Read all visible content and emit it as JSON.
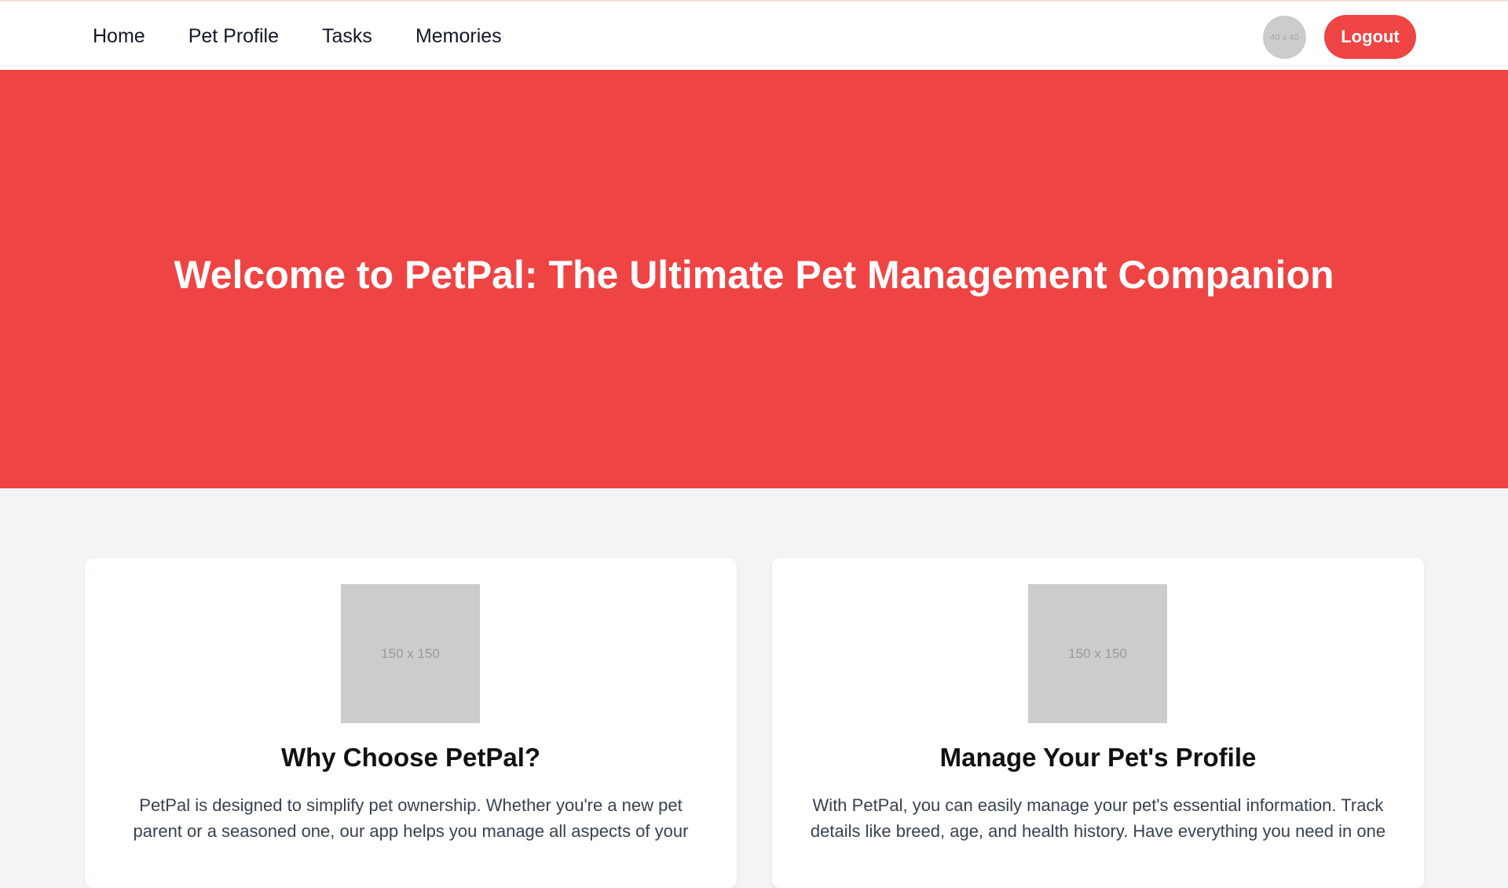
{
  "nav": {
    "items": [
      {
        "label": "Home"
      },
      {
        "label": "Pet Profile"
      },
      {
        "label": "Tasks"
      },
      {
        "label": "Memories"
      }
    ],
    "avatar_text": "40 x 40",
    "logout_label": "Logout"
  },
  "hero": {
    "title": "Welcome to PetPal: The Ultimate Pet Management Companion"
  },
  "cards": [
    {
      "image_text": "150 x 150",
      "title": "Why Choose PetPal?",
      "body": "PetPal is designed to simplify pet ownership. Whether you're a new pet parent or a seasoned one, our app helps you manage all aspects of your"
    },
    {
      "image_text": "150 x 150",
      "title": "Manage Your Pet's Profile",
      "body": "With PetPal, you can easily manage your pet's essential information. Track details like breed, age, and health history. Have everything you need in one"
    }
  ],
  "colors": {
    "accent": "#ef4444",
    "page_bg": "#f3f4f6",
    "placeholder": "#cccccc"
  }
}
